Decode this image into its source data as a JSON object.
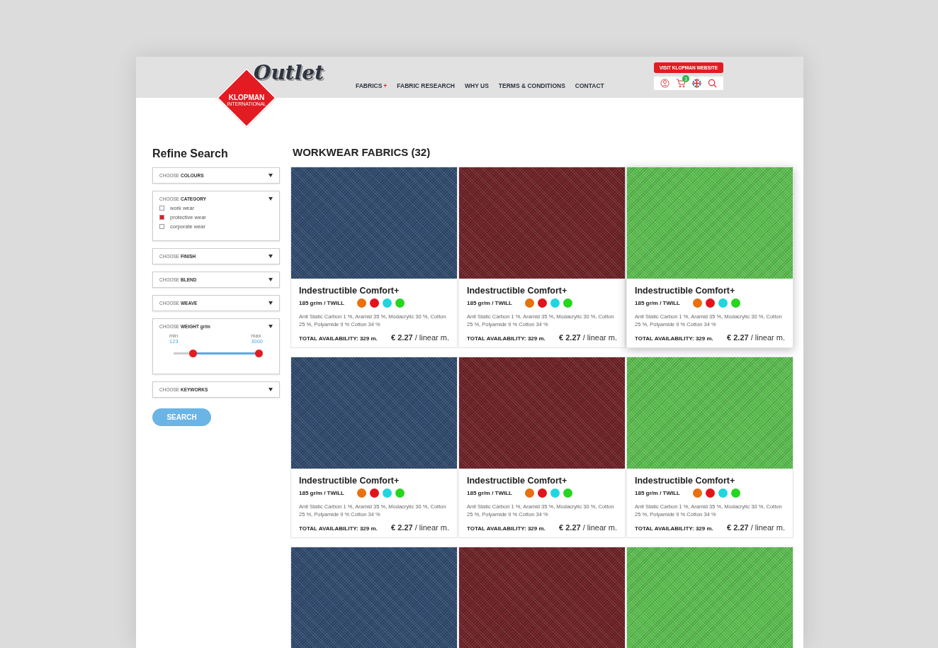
{
  "header": {
    "logo_script": "Outlet",
    "logo_brand": "KLOPMAN",
    "logo_sub": "INTERNATIONAL",
    "nav": [
      {
        "label": "FABRICS",
        "has_plus": true,
        "plus": "+"
      },
      {
        "label": "FABRIC RESEARCH",
        "has_plus": false
      },
      {
        "label": "WHY US",
        "has_plus": false
      },
      {
        "label": "TERMS & CONDITIONS",
        "has_plus": false
      },
      {
        "label": "CONTACT",
        "has_plus": false
      }
    ],
    "visit_button": "VISIT KLOPMAN WEBSITE",
    "cart_count": "3"
  },
  "sidebar": {
    "title": "Refine Search",
    "filters": [
      {
        "kind": "dropdown",
        "prefix": "CHOOSE",
        "label": "COLOURS"
      },
      {
        "kind": "checklist",
        "prefix": "CHOOSE",
        "label": "CATEGORY",
        "options": [
          {
            "label": "work wear",
            "checked": false
          },
          {
            "label": "protective wear",
            "checked": true
          },
          {
            "label": "corporate wear",
            "checked": false
          }
        ]
      },
      {
        "kind": "dropdown",
        "prefix": "CHOOSE",
        "label": "FINISH"
      },
      {
        "kind": "dropdown",
        "prefix": "CHOOSE",
        "label": "BLEND"
      },
      {
        "kind": "dropdown",
        "prefix": "CHOOSE",
        "label": "WEAVE"
      },
      {
        "kind": "range",
        "prefix": "CHOOSE",
        "label": "WEIGHT gr/m",
        "min_label": "min",
        "min_value": "123",
        "max_label": "max",
        "max_value": "3000",
        "thumbs": [
          {
            "level": 0.23
          },
          {
            "level": 1
          }
        ]
      },
      {
        "kind": "dropdown",
        "prefix": "CHOOSE",
        "label": "KEYWORKS"
      }
    ],
    "search_button": "SEARCH"
  },
  "results": {
    "title": "WORKWEAR FABRICS (32)",
    "products": [
      {
        "color": "#2f4a6e",
        "highlighted": false,
        "name": "Indestructible Comfort+",
        "spec": "185 gr/m / TWILL",
        "colors": [
          {
            "color": "#e8700f"
          },
          {
            "color": "#e0141c"
          },
          {
            "color": "#1fd6e0"
          },
          {
            "color": "#25d61f"
          }
        ],
        "composition": "Anti Static Carbon 1 %, Aramid 35 %, Modacrylic 30 %, Cotton 25 %, Polyamide 9 % Cotton 34 %",
        "availability": "TOTAL AVAILABILITY: 329 m.",
        "price": "€ 2.27",
        "unit": "/ linear m."
      },
      {
        "color": "#6e2126",
        "highlighted": false,
        "name": "Indestructible Comfort+",
        "spec": "185 gr/m / TWILL",
        "colors": [
          {
            "color": "#e8700f"
          },
          {
            "color": "#e0141c"
          },
          {
            "color": "#1fd6e0"
          },
          {
            "color": "#25d61f"
          }
        ],
        "composition": "Anti Static Carbon 1 %, Aramid 35 %, Modacrylic 30 %, Cotton 25 %, Polyamide 9 % Cotton 34 %",
        "availability": "TOTAL AVAILABILITY: 329 m.",
        "price": "€ 2.27",
        "unit": "/ linear m."
      },
      {
        "color": "#5cc050",
        "highlighted": true,
        "name": "Indestructible Comfort+",
        "spec": "185 gr/m / TWILL",
        "colors": [
          {
            "color": "#e8700f"
          },
          {
            "color": "#e0141c"
          },
          {
            "color": "#1fd6e0"
          },
          {
            "color": "#25d61f"
          }
        ],
        "composition": "Anti Static Carbon 1 %, Aramid 35 %, Modacrylic 30 %, Cotton 25 %, Polyamide 9 % Cotton 34 %",
        "availability": "TOTAL AVAILABILITY: 329 m.",
        "price": "€ 2.27",
        "unit": "/ linear m."
      },
      {
        "color": "#2f4a6e",
        "highlighted": false,
        "name": "Indestructible Comfort+",
        "spec": "185 gr/m / TWILL",
        "colors": [
          {
            "color": "#e8700f"
          },
          {
            "color": "#e0141c"
          },
          {
            "color": "#1fd6e0"
          },
          {
            "color": "#25d61f"
          }
        ],
        "composition": "Anti Static Carbon 1 %, Aramid 35 %, Modacrylic 30 %, Cotton 25 %, Polyamide 9 % Cotton 34 %",
        "availability": "TOTAL AVAILABILITY: 329 m.",
        "price": "€ 2.27",
        "unit": "/ linear m."
      },
      {
        "color": "#6e2126",
        "highlighted": false,
        "name": "Indestructible Comfort+",
        "spec": "185 gr/m / TWILL",
        "colors": [
          {
            "color": "#e8700f"
          },
          {
            "color": "#e0141c"
          },
          {
            "color": "#1fd6e0"
          },
          {
            "color": "#25d61f"
          }
        ],
        "composition": "Anti Static Carbon 1 %, Aramid 35 %, Modacrylic 30 %, Cotton 25 %, Polyamide 9 % Cotton 34 %",
        "availability": "TOTAL AVAILABILITY: 329 m.",
        "price": "€ 2.27",
        "unit": "/ linear m."
      },
      {
        "color": "#5cc050",
        "highlighted": false,
        "name": "Indestructible Comfort+",
        "spec": "185 gr/m / TWILL",
        "colors": [
          {
            "color": "#e8700f"
          },
          {
            "color": "#e0141c"
          },
          {
            "color": "#1fd6e0"
          },
          {
            "color": "#25d61f"
          }
        ],
        "composition": "Anti Static Carbon 1 %, Aramid 35 %, Modacrylic 30 %, Cotton 25 %, Polyamide 9 % Cotton 34 %",
        "availability": "TOTAL AVAILABILITY: 329 m.",
        "price": "€ 2.27",
        "unit": "/ linear m."
      }
    ],
    "partial_products": [
      {
        "color": "#2f4a6e"
      },
      {
        "color": "#6e2126"
      },
      {
        "color": "#5cc050"
      }
    ]
  }
}
